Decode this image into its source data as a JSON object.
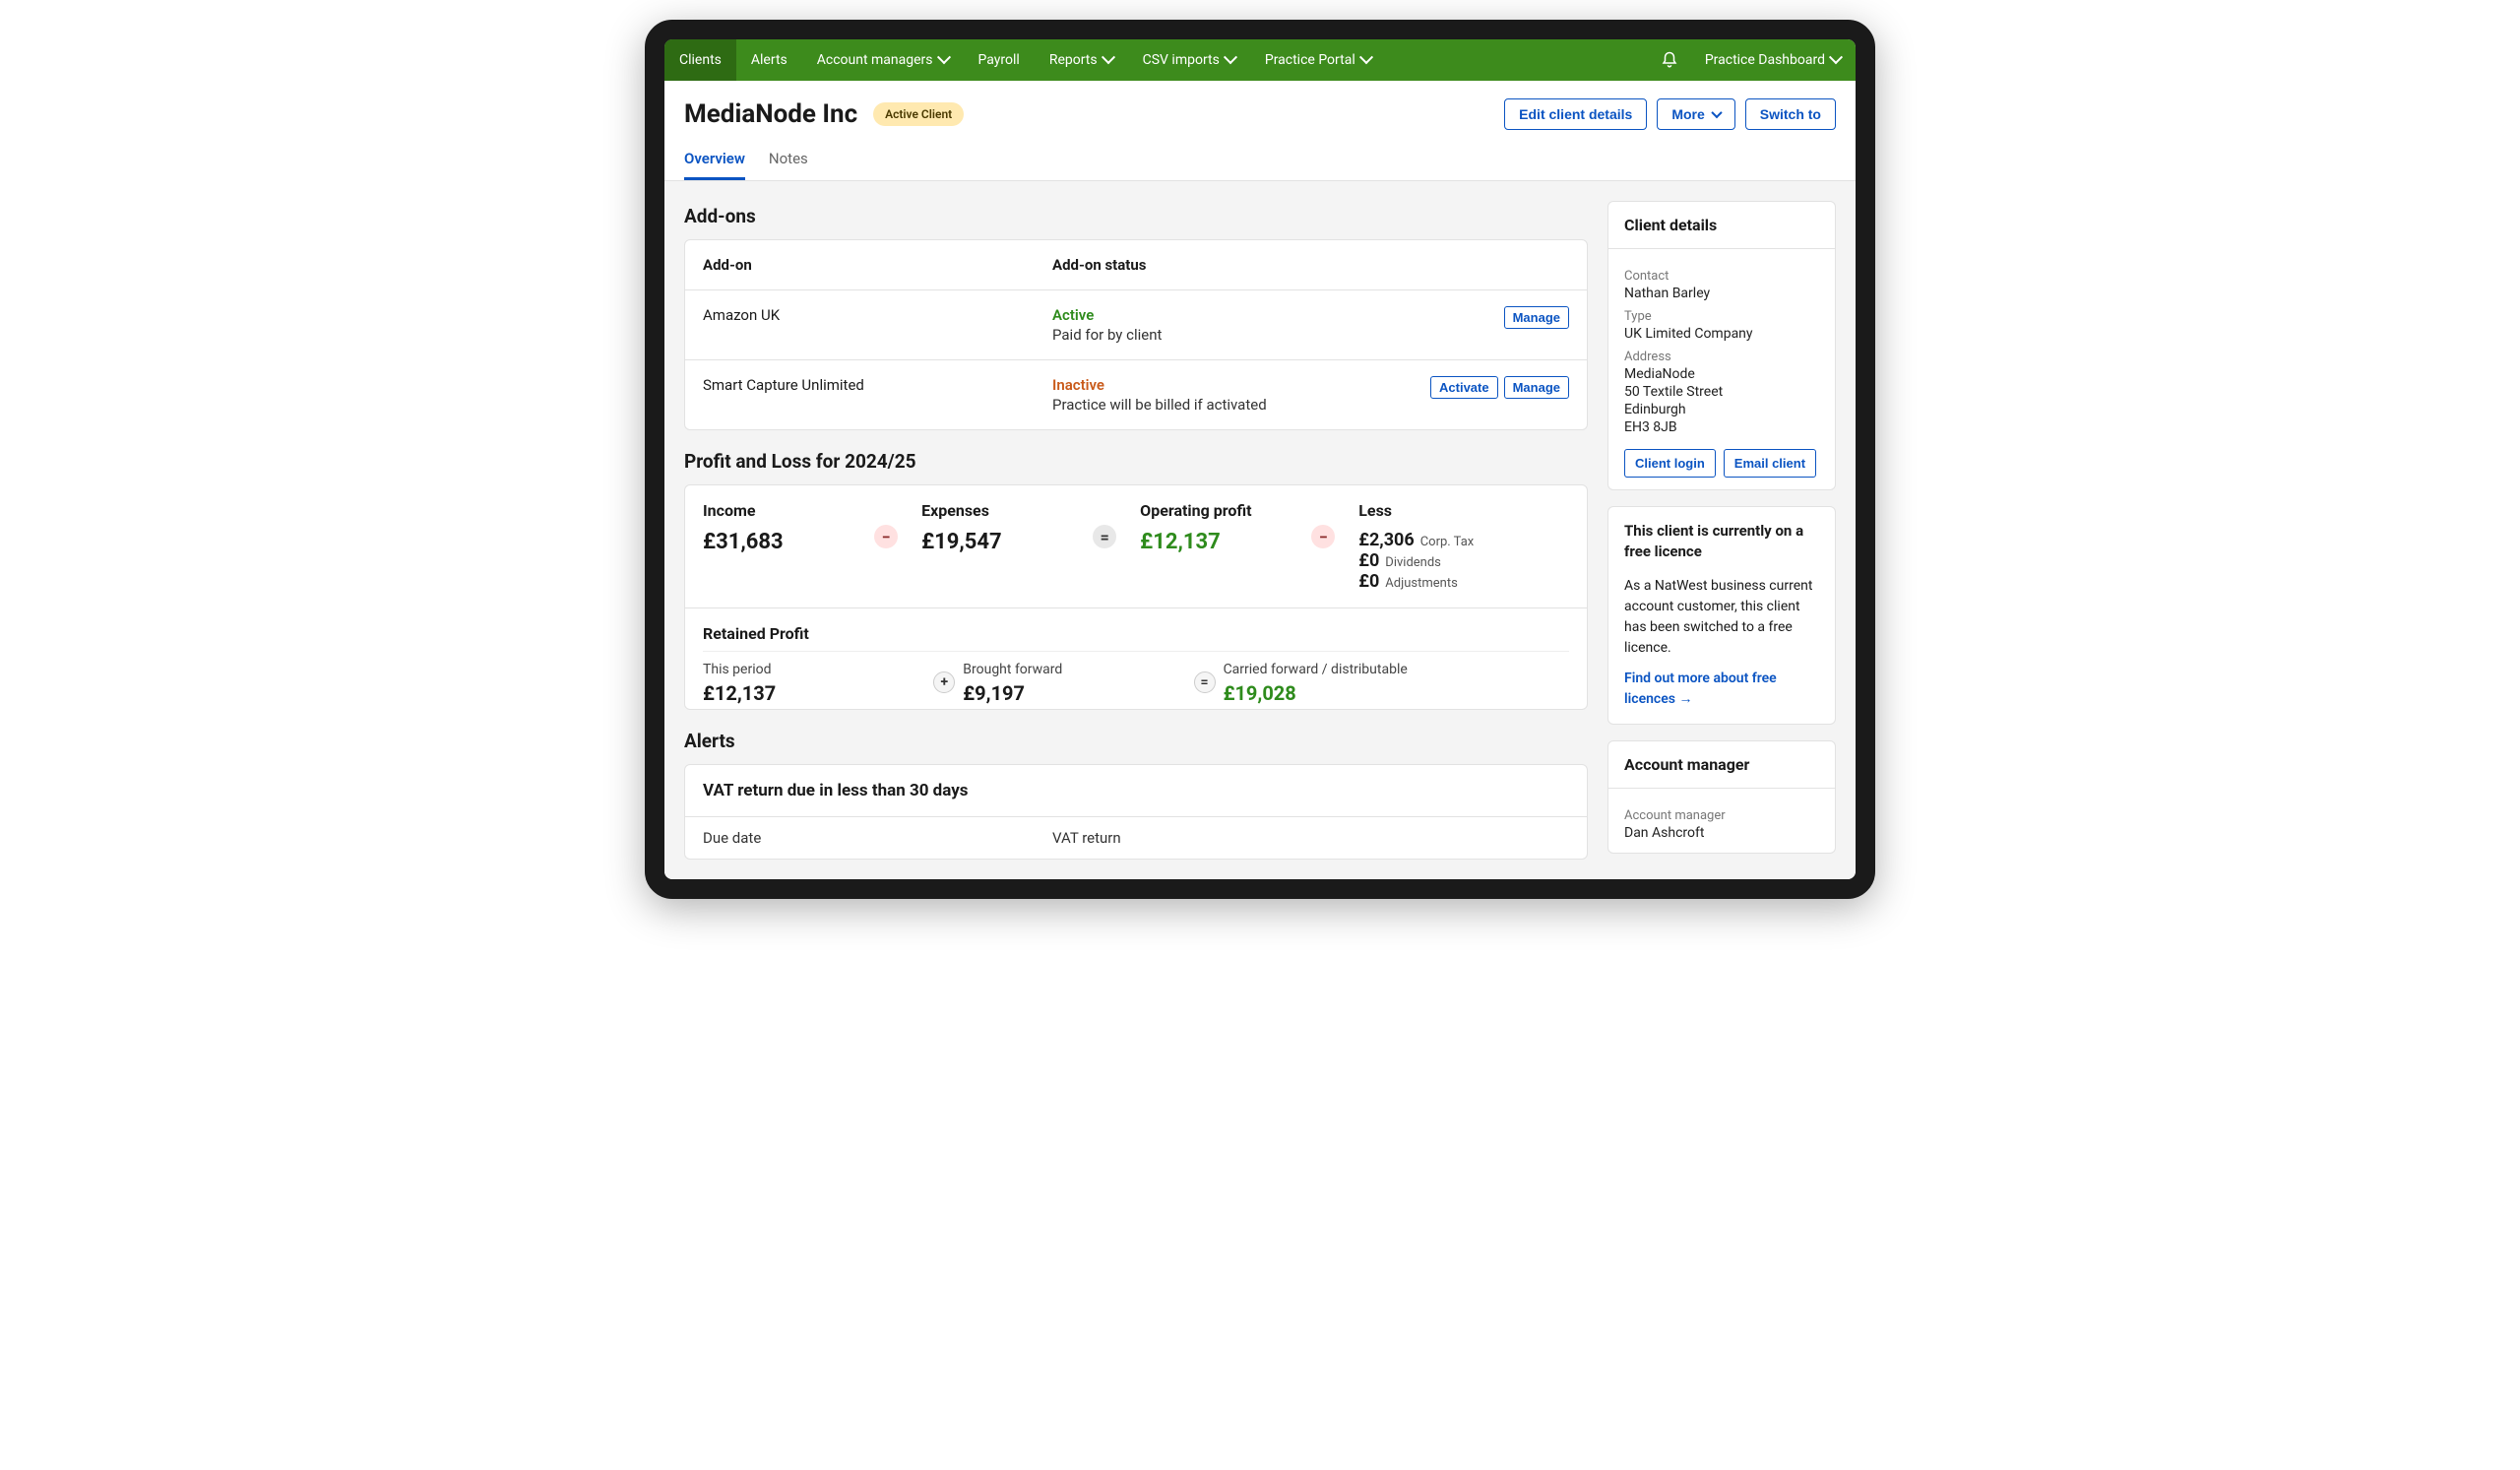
{
  "topnav": {
    "items": [
      {
        "label": "Clients",
        "active": true,
        "dropdown": false
      },
      {
        "label": "Alerts",
        "active": false,
        "dropdown": false
      },
      {
        "label": "Account managers",
        "active": false,
        "dropdown": true
      },
      {
        "label": "Payroll",
        "active": false,
        "dropdown": false
      },
      {
        "label": "Reports",
        "active": false,
        "dropdown": true
      },
      {
        "label": "CSV imports",
        "active": false,
        "dropdown": true
      },
      {
        "label": "Practice Portal",
        "active": false,
        "dropdown": true
      }
    ],
    "right_label": "Practice Dashboard"
  },
  "header": {
    "client_name": "MediaNode Inc",
    "badge": "Active Client",
    "buttons": {
      "edit": "Edit client details",
      "more": "More",
      "switch": "Switch to"
    }
  },
  "tabs": {
    "overview": "Overview",
    "notes": "Notes"
  },
  "addons": {
    "title": "Add-ons",
    "col_name": "Add-on",
    "col_status": "Add-on status",
    "rows": [
      {
        "name": "Amazon UK",
        "status": "Active",
        "status_kind": "active",
        "sub": "Paid for by client",
        "actions": [
          "Manage"
        ]
      },
      {
        "name": "Smart Capture Unlimited",
        "status": "Inactive",
        "status_kind": "inactive",
        "sub": "Practice will be billed if activated",
        "actions": [
          "Activate",
          "Manage"
        ]
      }
    ]
  },
  "pl": {
    "title": "Profit and Loss for 2024/25",
    "income_label": "Income",
    "income": "£31,683",
    "expenses_label": "Expenses",
    "expenses": "£19,547",
    "op_profit_label": "Operating profit",
    "op_profit": "£12,137",
    "less_label": "Less",
    "less_items": [
      {
        "value": "£2,306",
        "label": "Corp. Tax"
      },
      {
        "value": "£0",
        "label": "Dividends"
      },
      {
        "value": "£0",
        "label": "Adjustments"
      }
    ],
    "retained_title": "Retained Profit",
    "this_period_label": "This period",
    "this_period": "£12,137",
    "brought_fwd_label": "Brought forward",
    "brought_fwd": "£9,197",
    "carried_fwd_label": "Carried forward / distributable",
    "carried_fwd": "£19,028"
  },
  "alerts": {
    "title": "Alerts",
    "heading": "VAT return due in less than 30 days",
    "col1": "Due date",
    "col2": "VAT return"
  },
  "client_details": {
    "title": "Client details",
    "contact_label": "Contact",
    "contact": "Nathan Barley",
    "type_label": "Type",
    "type": "UK Limited Company",
    "address_label": "Address",
    "address_lines": [
      "MediaNode",
      "50 Textile Street",
      "Edinburgh",
      "EH3 8JB"
    ],
    "btn_login": "Client login",
    "btn_email": "Email client"
  },
  "licence": {
    "title": "This client is currently on a free licence",
    "body": "As a NatWest business current account customer, this client has been switched to a free licence.",
    "link": "Find out more about free licences →"
  },
  "account_manager": {
    "title": "Account manager",
    "label": "Account manager",
    "name": "Dan Ashcroft"
  }
}
